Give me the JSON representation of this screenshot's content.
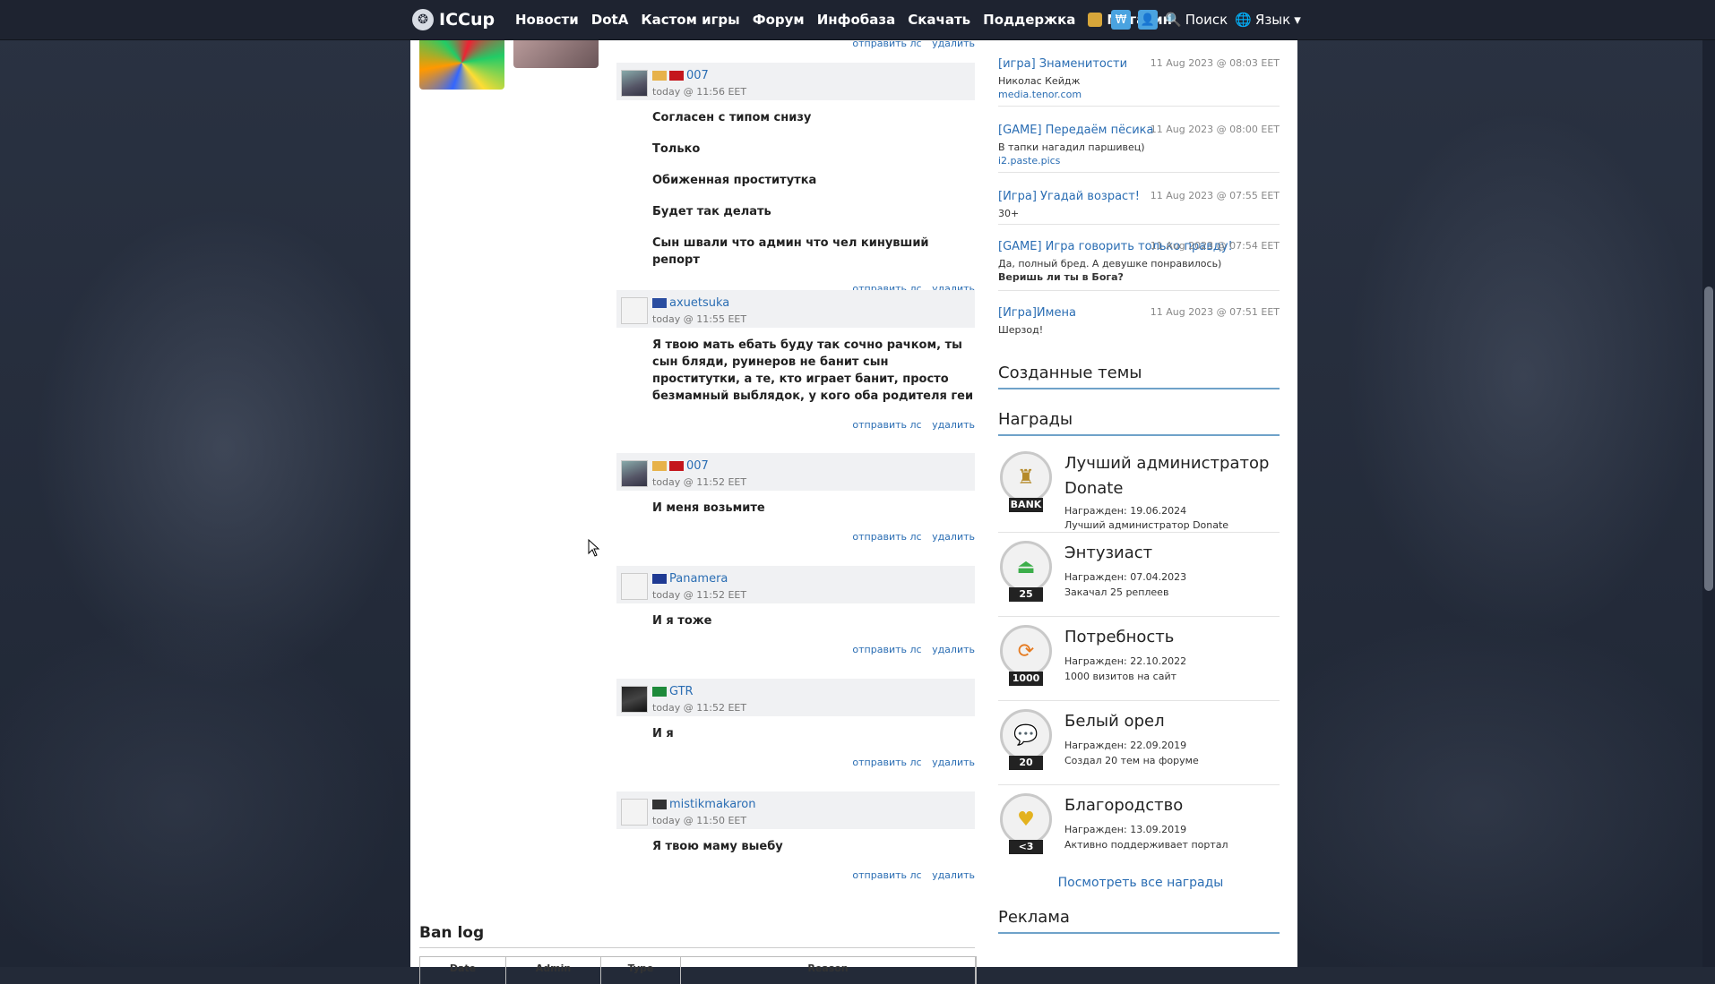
{
  "topbar": {
    "logo": "ICCup",
    "nav": [
      "Новости",
      "DotA",
      "Кастом игры",
      "Форум",
      "Инфобаза",
      "Скачать",
      "Поддержка"
    ],
    "shop": "Магазин",
    "search": "Поиск",
    "language": "Язык"
  },
  "comments": [
    {
      "name": "007",
      "time": "today @ 11:56 EET",
      "lines": [
        "Согласен с типом снизу",
        "Только",
        "Обиженная проститутка",
        "Будет так делать",
        "Сын швали что админ что чел кинувший репорт"
      ]
    },
    {
      "name": "axuetsuka",
      "time": "today @ 11:55 EET",
      "lines": [
        "Я твою мать ебать буду так сочно рачком, ты сын бляди, руинеров не банит сын проститутки, а те, кто играет банит, просто безмамный выблядок, у кого оба родителя геи"
      ]
    },
    {
      "name": "007",
      "time": "today @ 11:52 EET",
      "lines": [
        "И меня возьмите"
      ]
    },
    {
      "name": "Panamera",
      "time": "today @ 11:52 EET",
      "lines": [
        "И я тоже"
      ]
    },
    {
      "name": "GTR",
      "time": "today @ 11:52 EET",
      "lines": [
        "И я"
      ]
    },
    {
      "name": "mistikmakaron",
      "time": "today @ 11:50 EET",
      "lines": [
        "Я твою маму выебу"
      ]
    }
  ],
  "actions": {
    "pm": "отправить лс",
    "delete": "удалить"
  },
  "banlog": {
    "title": "Ban log",
    "columns": [
      "Date",
      "Admin",
      "Type",
      "Reason"
    ]
  },
  "sidebar": {
    "topics": [
      {
        "title": "[игра] Знаменитости",
        "date": "11 Aug 2023 @ 08:03 EET",
        "sub": "Николас Кейдж",
        "link": "media.tenor.com"
      },
      {
        "title": "[GAME] Передаём пёсика",
        "date": "11 Aug 2023 @ 08:00 EET",
        "sub": "В тапки нагадил паршивец)",
        "link": "i2.paste.pics"
      },
      {
        "title": "[Игра] Угадай возраст!",
        "date": "11 Aug 2023 @ 07:55 EET",
        "sub": "30+",
        "link": ""
      },
      {
        "title": "[GAME] Игра говорить только правду!",
        "date": "11 Aug 2023 @ 07:54 EET",
        "sub": "Да, полный бред. А девушке понравилось)",
        "link2": "Веришь ли ты в Бога?"
      },
      {
        "title": "[Игра]Имена",
        "date": "11 Aug 2023 @ 07:51 EET",
        "sub": "Шерзод!",
        "link": ""
      }
    ],
    "created_heading": "Созданные темы",
    "awards_heading": "Награды",
    "awards": [
      {
        "name": "Лучший администратор Donate",
        "date": "Награжден: 19.06.2024",
        "desc": "Лучший администратор Donate",
        "tag": "BANK",
        "icon": "tower-icon",
        "color": "#b58a2a"
      },
      {
        "name": "Энтузиаст",
        "date": "Награжден: 07.04.2023",
        "desc": "Закачал 25 реплеев",
        "tag": "25",
        "icon": "eject-icon",
        "color": "#3cae4a"
      },
      {
        "name": "Потребность",
        "date": "Награжден: 22.10.2022",
        "desc": "1000 визитов на сайт",
        "tag": "1000",
        "icon": "refresh-icon",
        "color": "#e57a1f"
      },
      {
        "name": "Белый орел",
        "date": "Награжден: 22.09.2019",
        "desc": "Создал 20 тем на форуме",
        "tag": "20",
        "icon": "chat-icon",
        "color": "#e8641f"
      },
      {
        "name": "Благородство",
        "date": "Награжден: 13.09.2019",
        "desc": "Активно поддерживает портал",
        "tag": "<3",
        "icon": "heart-icon",
        "color": "#e3b21f"
      }
    ],
    "all_awards": "Посмотреть все награды",
    "ads_heading": "Реклама"
  }
}
